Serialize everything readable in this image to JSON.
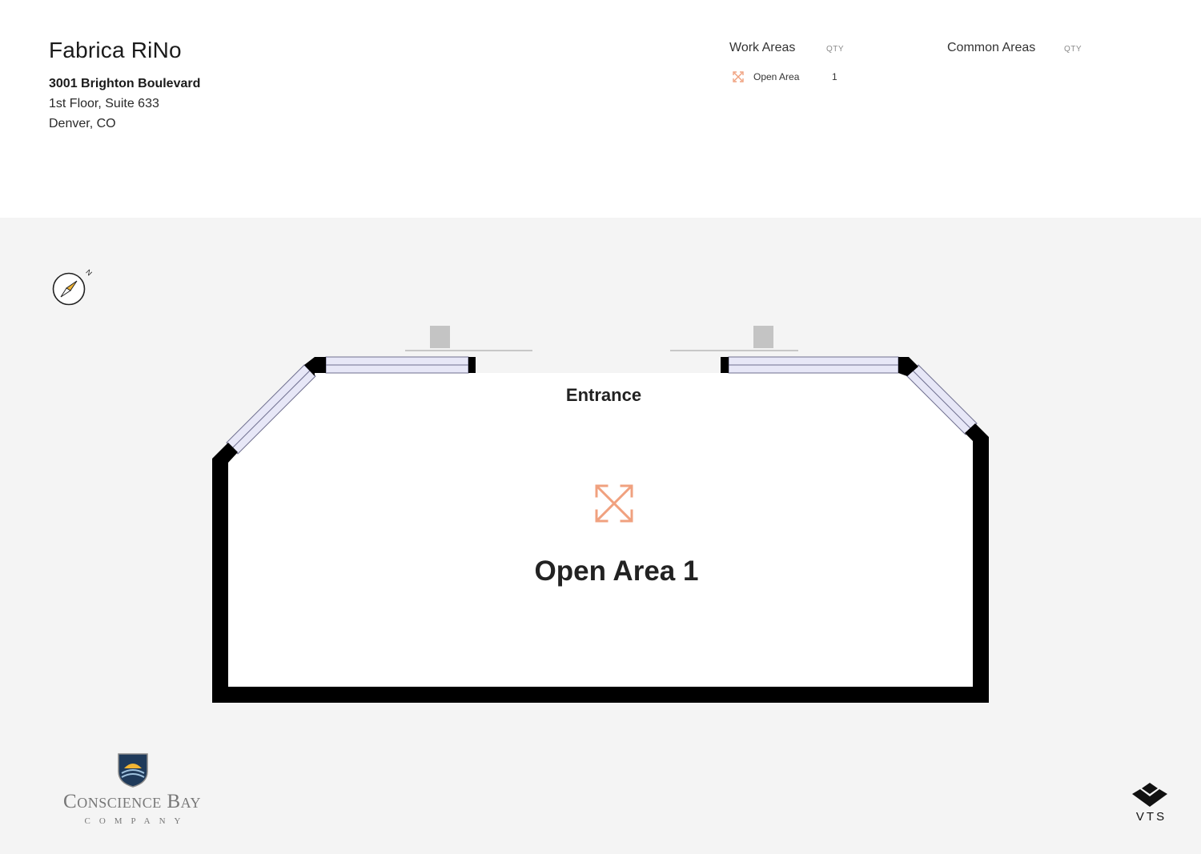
{
  "property": {
    "name": "Fabrica RiNo",
    "address_line1": "3001 Brighton Boulevard",
    "address_line2": "1st Floor, Suite 633",
    "address_line3": "Denver, CO"
  },
  "legend": {
    "work_areas": {
      "heading": "Work Areas",
      "qty_label": "QTY",
      "items": [
        {
          "label": "Open Area",
          "qty": "1",
          "icon": "expand-arrows-icon",
          "color": "#f0a17f"
        }
      ]
    },
    "common_areas": {
      "heading": "Common Areas",
      "qty_label": "QTY",
      "items": []
    }
  },
  "floor_plan": {
    "entrance_label": "Entrance",
    "areas": [
      {
        "label": "Open Area 1",
        "type": "Open Area",
        "icon": "expand-arrows-icon"
      }
    ],
    "compass_label": "N",
    "colors": {
      "wall": "#000000",
      "window_fill": "#e7e7f7",
      "window_stroke": "#6f6f8f",
      "background": "#f4f4f4",
      "area_icon": "#f0a17f"
    }
  },
  "logos": {
    "landlord_name": "Conscience Bay",
    "landlord_sub": "COMPANY",
    "platform": "VTS"
  }
}
